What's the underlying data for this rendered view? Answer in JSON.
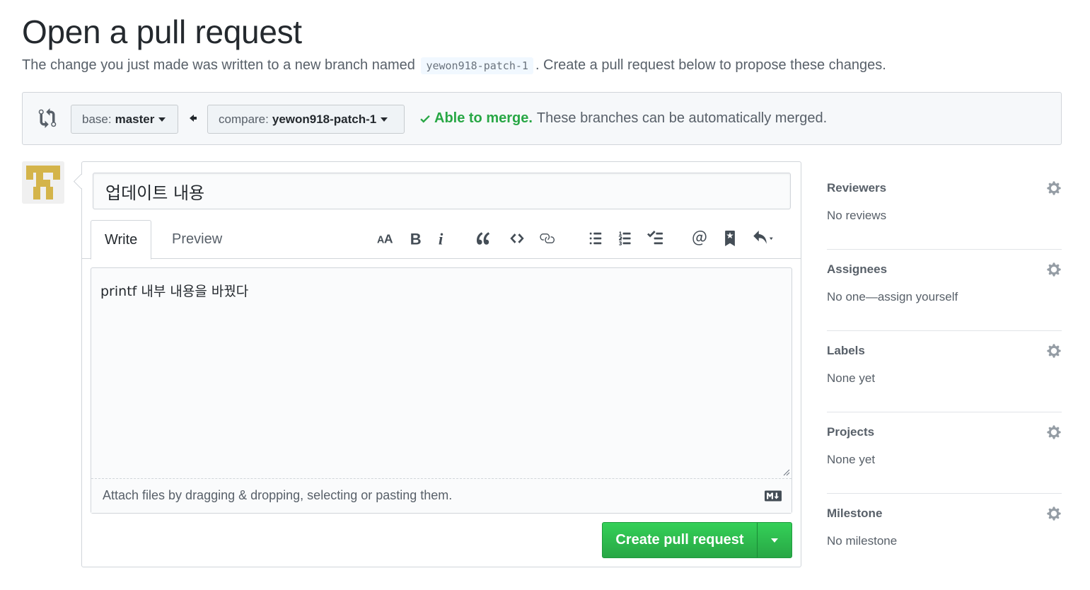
{
  "page": {
    "title": "Open a pull request",
    "subtitle_before": "The change you just made was written to a new branch named",
    "branch_name": "yewon918-patch-1",
    "subtitle_after": ". Create a pull request below to propose these changes."
  },
  "range": {
    "base_label": "base:",
    "base_value": "master",
    "compare_label": "compare:",
    "compare_value": "yewon918-patch-1",
    "merge_ok": "Able to merge.",
    "merge_msg": "These branches can be automatically merged."
  },
  "form": {
    "title_value": "업데이트 내용",
    "tab_write": "Write",
    "tab_preview": "Preview",
    "toolbar_icons": [
      "text-size-icon",
      "bold-icon",
      "italic-icon",
      "quote-icon",
      "code-icon",
      "link-icon",
      "unordered-list-icon",
      "ordered-list-icon",
      "task-list-icon",
      "mention-icon",
      "saved-reply-icon",
      "reply-icon"
    ],
    "body_value": "printf 내부 내용을 바꿨다",
    "drop_hint": "Attach files by dragging & dropping, selecting or pasting them.",
    "submit_label": "Create pull request"
  },
  "sidebar": {
    "sections": [
      {
        "heading": "Reviewers",
        "value": "No reviews"
      },
      {
        "heading": "Assignees",
        "value": "No one—assign yourself"
      },
      {
        "heading": "Labels",
        "value": "None yet"
      },
      {
        "heading": "Projects",
        "value": "None yet"
      },
      {
        "heading": "Milestone",
        "value": "No milestone"
      }
    ]
  },
  "colors": {
    "green": "#28a745",
    "text": "#24292e",
    "muted": "#586069",
    "border": "#d1d5da"
  }
}
